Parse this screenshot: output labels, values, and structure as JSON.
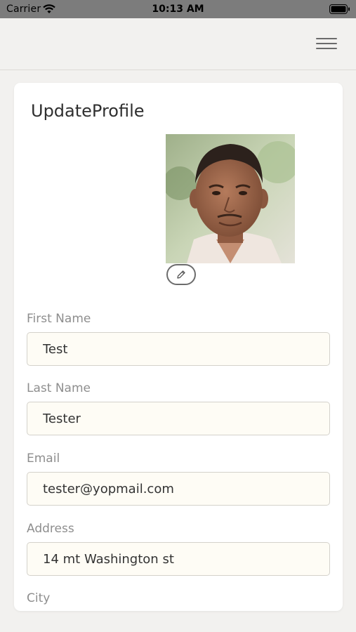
{
  "status_bar": {
    "carrier": "Carrier",
    "time": "10:13 AM",
    "wifi_icon": "wifi-icon",
    "battery_icon": "battery-icon"
  },
  "nav": {
    "menu_icon": "hamburger-menu-icon"
  },
  "profile": {
    "title": "UpdateProfile",
    "edit_icon": "pencil-icon"
  },
  "form": {
    "first_name": {
      "label": "First Name",
      "value": "Test"
    },
    "last_name": {
      "label": "Last Name",
      "value": "Tester"
    },
    "email": {
      "label": "Email",
      "value": "tester@yopmail.com"
    },
    "address": {
      "label": "Address",
      "value": "14 mt Washington st"
    },
    "city": {
      "label": "City"
    }
  },
  "colors": {
    "background": "#f2f1ef",
    "card": "#ffffff",
    "input_background": "#fefcf5",
    "input_border": "#d4d2cb",
    "label": "#8e8e8e",
    "text": "#333333"
  }
}
